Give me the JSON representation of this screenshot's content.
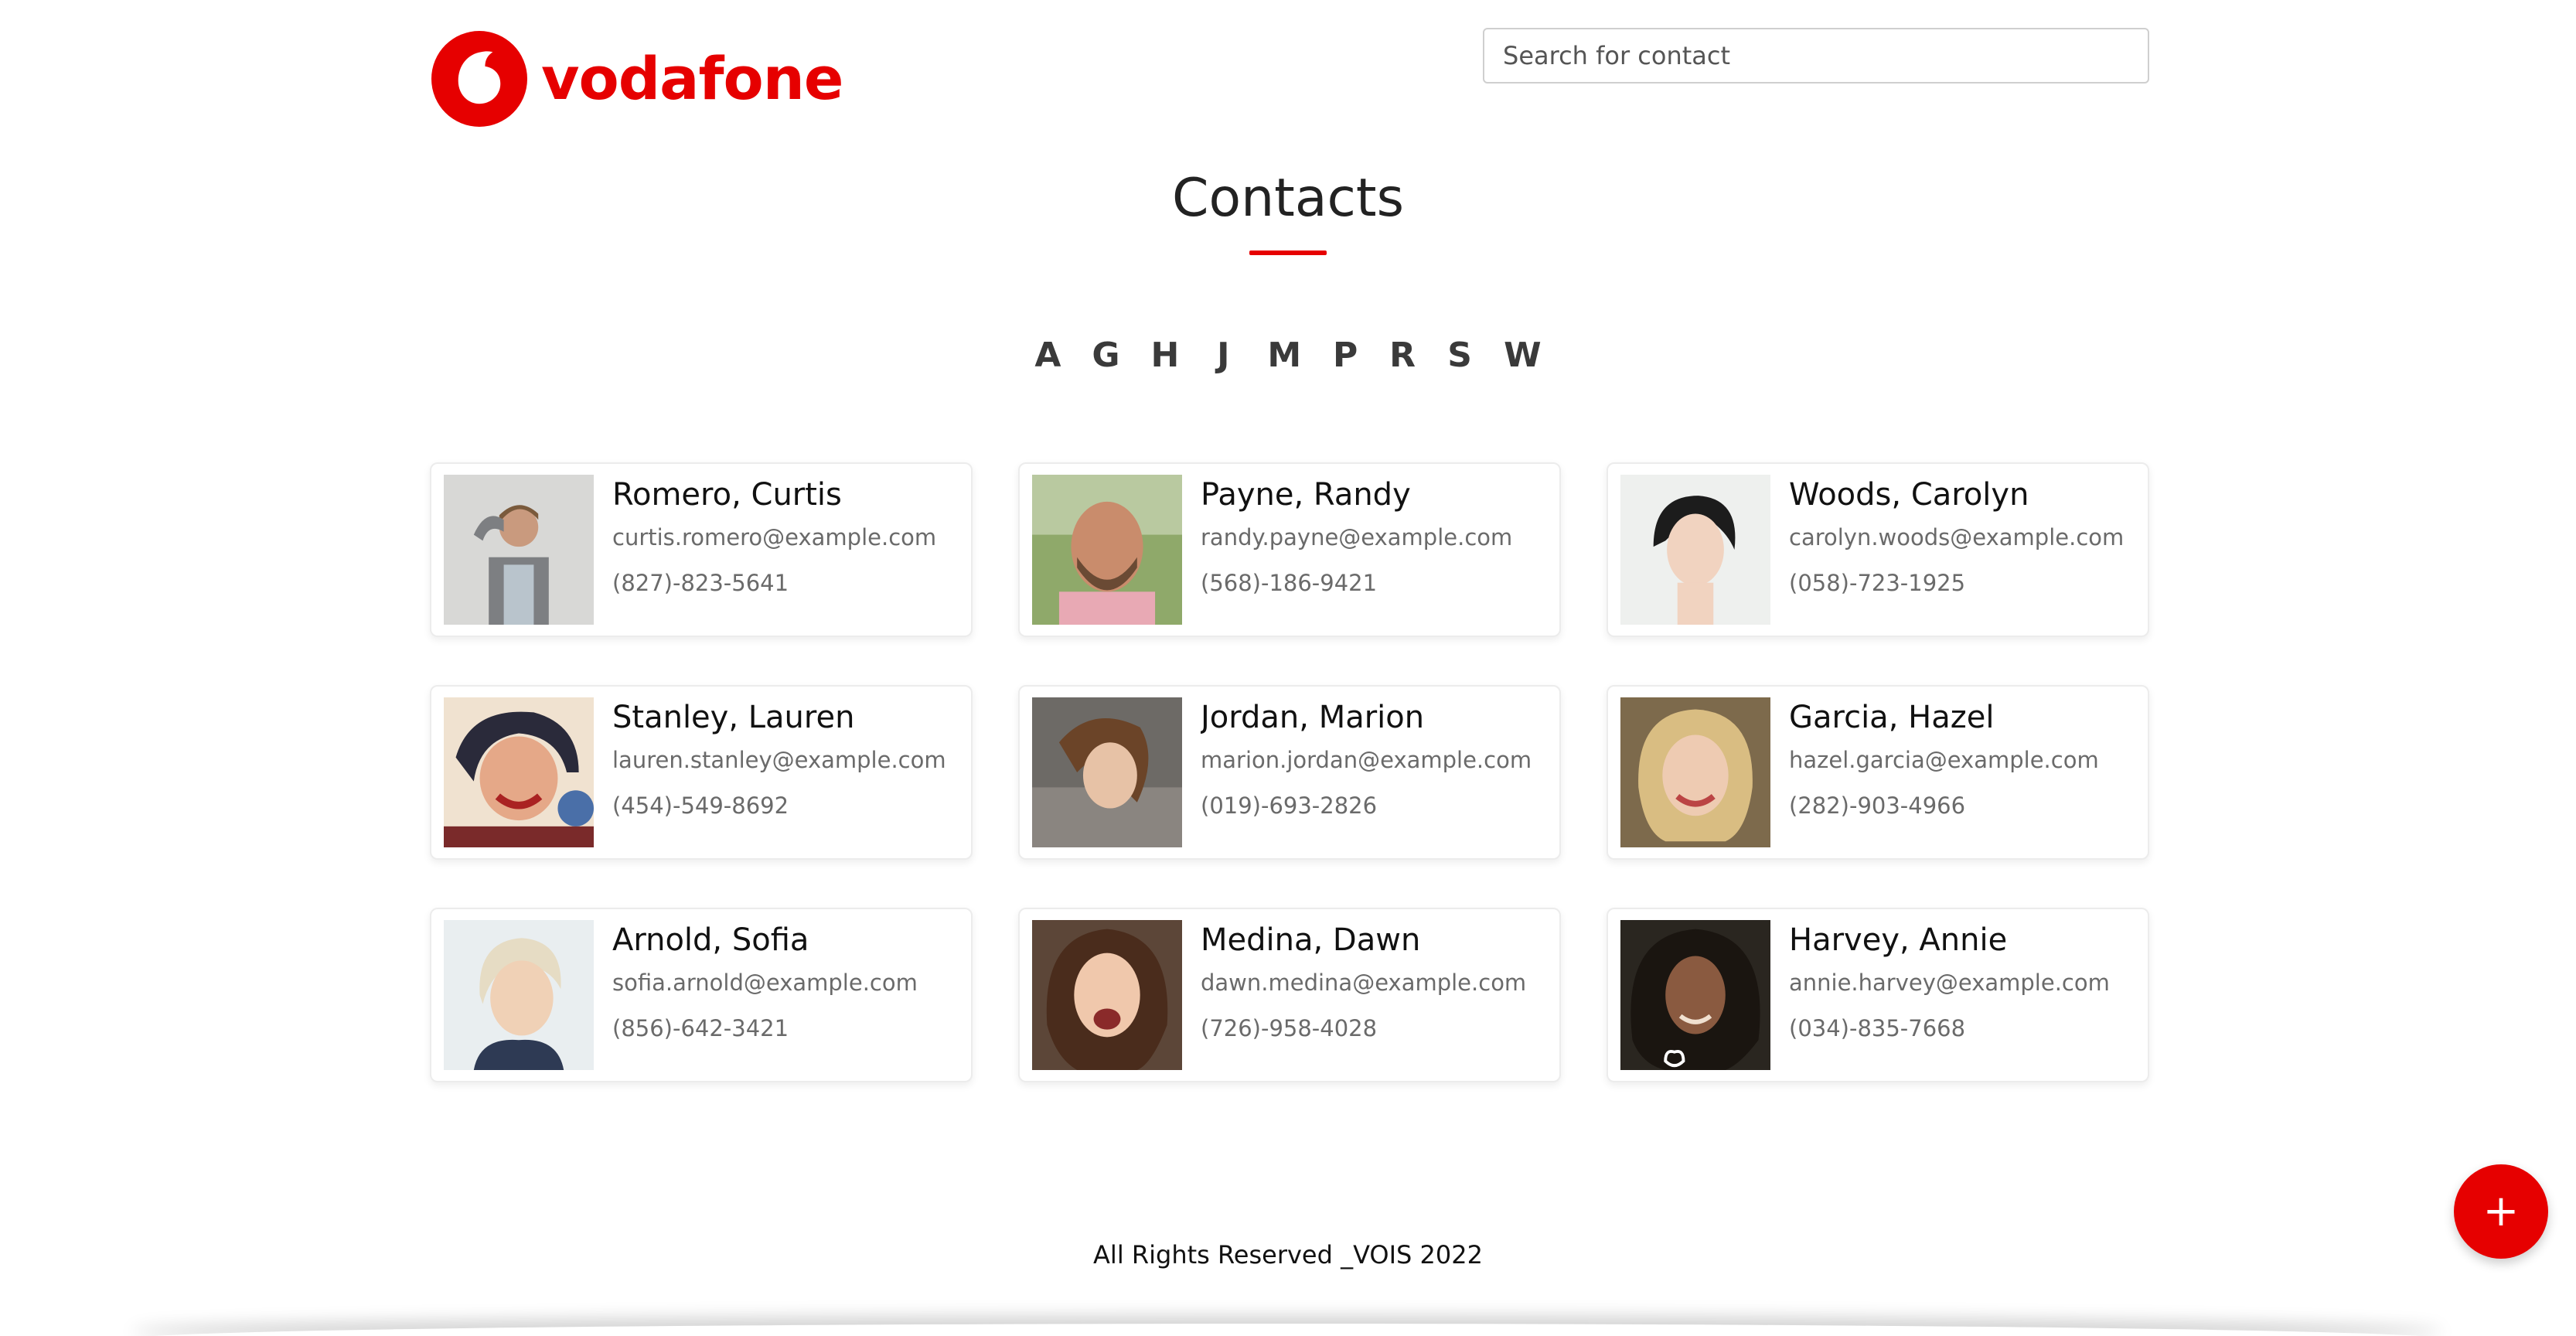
{
  "header": {
    "logo_text": "vodafone",
    "search_placeholder": "Search for contact",
    "search_value": ""
  },
  "main": {
    "title": "Contacts",
    "alphabet": [
      "A",
      "G",
      "H",
      "J",
      "M",
      "P",
      "R",
      "S",
      "W"
    ],
    "contacts": [
      {
        "name": "Romero, Curtis",
        "email": "curtis.romero@example.com",
        "phone": "(827)-823-5641"
      },
      {
        "name": "Payne, Randy",
        "email": "randy.payne@example.com",
        "phone": "(568)-186-9421"
      },
      {
        "name": "Woods, Carolyn",
        "email": "carolyn.woods@example.com",
        "phone": "(058)-723-1925"
      },
      {
        "name": "Stanley, Lauren",
        "email": "lauren.stanley@example.com",
        "phone": "(454)-549-8692"
      },
      {
        "name": "Jordan, Marion",
        "email": "marion.jordan@example.com",
        "phone": "(019)-693-2826"
      },
      {
        "name": "Garcia, Hazel",
        "email": "hazel.garcia@example.com",
        "phone": "(282)-903-4966"
      },
      {
        "name": "Arnold, Sofia",
        "email": "sofia.arnold@example.com",
        "phone": "(856)-642-3421"
      },
      {
        "name": "Medina, Dawn",
        "email": "dawn.medina@example.com",
        "phone": "(726)-958-4028"
      },
      {
        "name": "Harvey, Annie",
        "email": "annie.harvey@example.com",
        "phone": "(034)-835-7668"
      }
    ]
  },
  "fab": {
    "label": "+",
    "icon": "plus-icon"
  },
  "footer": {
    "text": "All Rights Reserved _VOIS 2022"
  },
  "colors": {
    "brand": "#e60000",
    "text": "#222222",
    "muted": "#6a6a6a",
    "card_border": "#ececec"
  }
}
